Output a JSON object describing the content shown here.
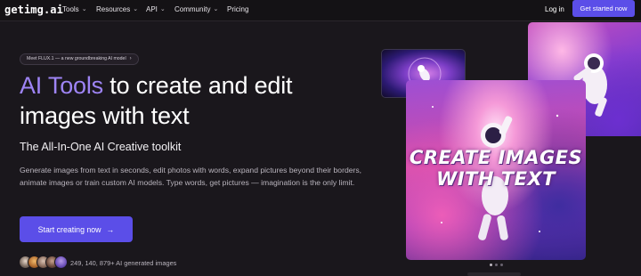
{
  "nav": {
    "logo": "getimg.ai",
    "items": [
      {
        "label": "Tools",
        "has_dropdown": true
      },
      {
        "label": "Resources",
        "has_dropdown": true
      },
      {
        "label": "API",
        "has_dropdown": true
      },
      {
        "label": "Community",
        "has_dropdown": true
      },
      {
        "label": "Pricing",
        "has_dropdown": false
      }
    ],
    "login_label": "Log in",
    "cta_label": "Get started now"
  },
  "hero": {
    "announcement": "Meet FLUX.1 — a new groundbreaking AI model",
    "headline_accent": "AI Tools",
    "headline_rest": " to create and edit images with text",
    "subtitle": "The All-In-One AI Creative toolkit",
    "description": "Generate images from text in seconds, edit photos with words, expand pictures beyond their borders, animate images or train custom AI models. Type words, get pictures — imagination is the only limit.",
    "cta_label": "Start creating now",
    "social_proof": "249, 140, 879+ AI generated images",
    "image_caption": "CREATE IMAGES WITH TEXT"
  },
  "colors": {
    "accent": "#5b4ee8",
    "accent_text": "#9e84f5",
    "background": "#1a171c"
  },
  "icons": {
    "dropdown": "chevron-down-icon",
    "pill_arrow": "chevron-right-icon",
    "cta_arrow": "arrow-right-icon"
  }
}
